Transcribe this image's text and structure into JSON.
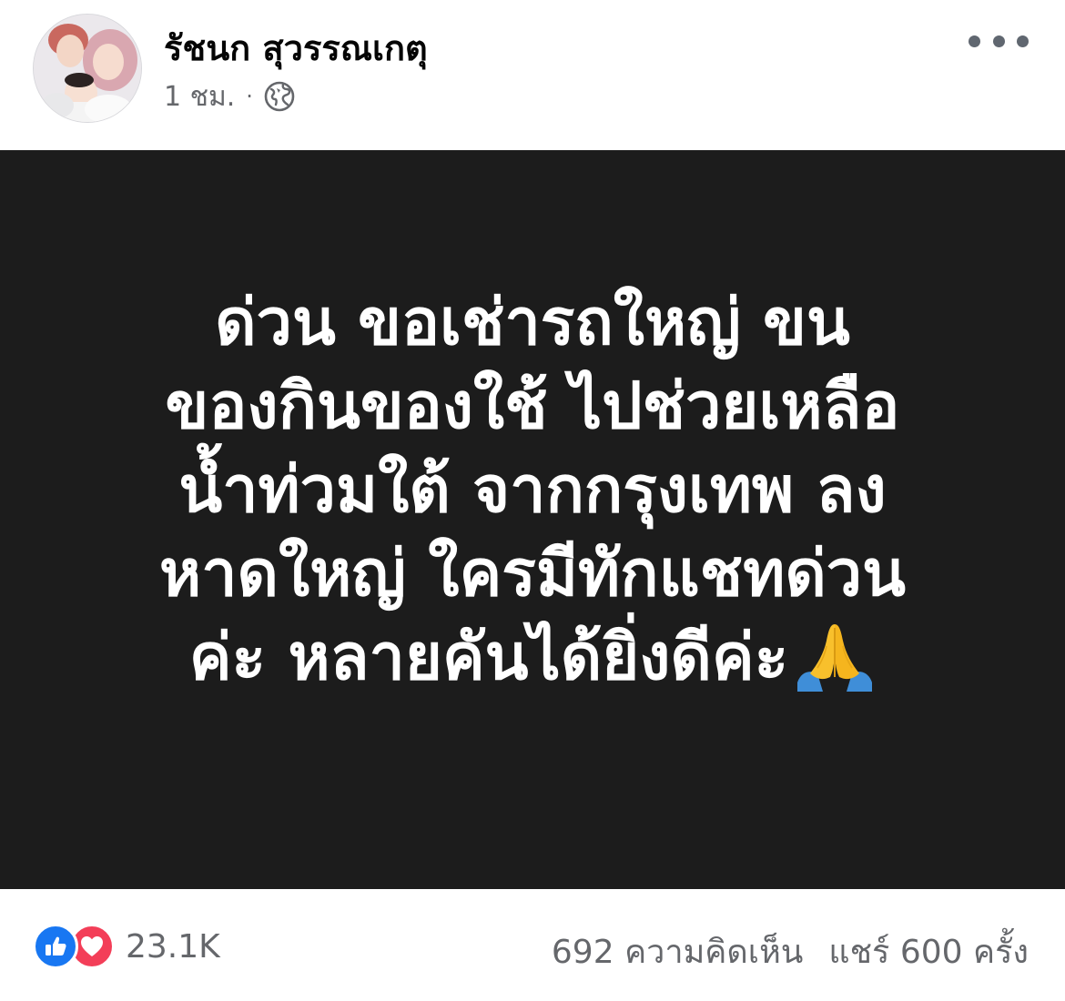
{
  "post": {
    "author": "รัชนก สุวรรณเกตุ",
    "time": "1 ชม.",
    "separator": "·",
    "privacy_icon": "globe-icon",
    "more_icon": "more-options-icon"
  },
  "card": {
    "background": "#1c1c1c",
    "text_color": "#ffffff",
    "lines": [
      "ด่วน ขอเช่ารถใหญ่ ขน",
      "ของกินของใช้ ไปช่วยเหลือ",
      "น้ำท่วมใต้ จากกรุงเทพ ลง",
      "หาดใหญ่ ใครมีทักแชทด่วน",
      "ค่ะ หลายคันได้ยิ่งดีค่ะ"
    ],
    "emoji_icon": "folded-hands-icon"
  },
  "footer": {
    "reaction_icons": [
      "like-icon",
      "love-icon"
    ],
    "reaction_count": "23.1K",
    "comments": "692 ความคิดเห็น",
    "shares": "แชร์ 600 ครั้ง",
    "colors": {
      "like": "#1877f2",
      "love": "#f33e58",
      "meta": "#65676b"
    }
  }
}
